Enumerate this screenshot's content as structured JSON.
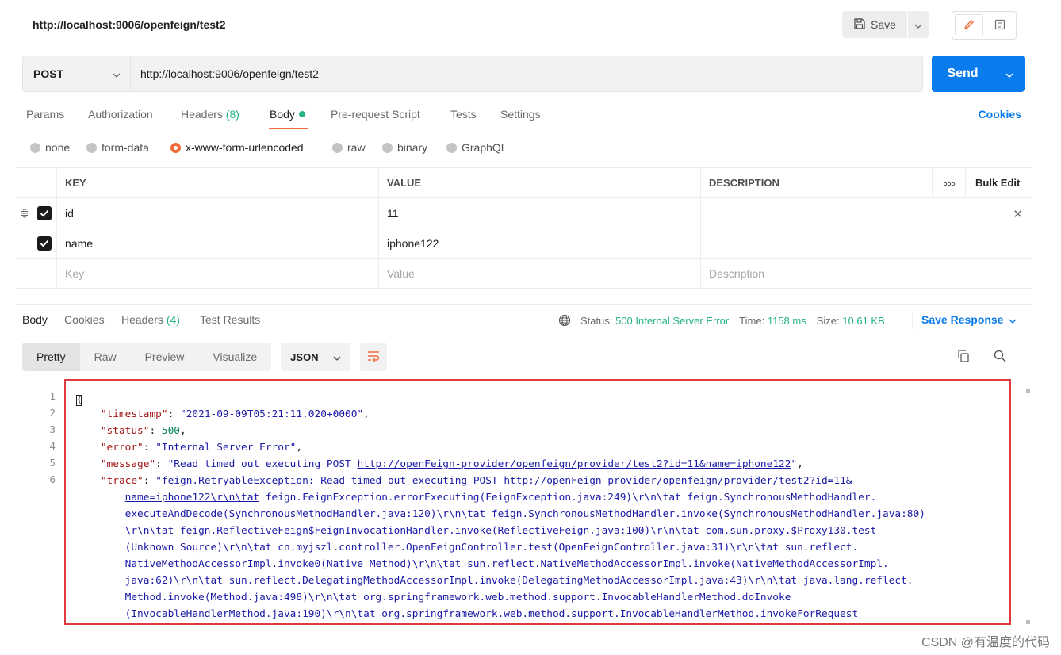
{
  "header": {
    "request_title": "http://localhost:9006/openfeign/test2",
    "save_label": "Save"
  },
  "url_bar": {
    "method": "POST",
    "url": "http://localhost:9006/openfeign/test2",
    "send_label": "Send"
  },
  "request_tabs": [
    {
      "label": "Params"
    },
    {
      "label": "Authorization"
    },
    {
      "label": "Headers",
      "count": "(8)"
    },
    {
      "label": "Body"
    },
    {
      "label": "Pre-request Script"
    },
    {
      "label": "Tests"
    },
    {
      "label": "Settings"
    }
  ],
  "cookies_label": "Cookies",
  "body_types": [
    "none",
    "form-data",
    "x-www-form-urlencoded",
    "raw",
    "binary",
    "GraphQL"
  ],
  "body_types_selected": "x-www-form-urlencoded",
  "params_table": {
    "headers": {
      "key": "KEY",
      "value": "VALUE",
      "description": "DESCRIPTION",
      "bulk_edit": "Bulk Edit"
    },
    "rows": [
      {
        "key": "id",
        "value": "11",
        "description": "",
        "checked": true
      },
      {
        "key": "name",
        "value": "iphone122",
        "description": "",
        "checked": true
      }
    ],
    "placeholders": {
      "key": "Key",
      "value": "Value",
      "description": "Description"
    }
  },
  "response": {
    "tabs": [
      {
        "label": "Body"
      },
      {
        "label": "Cookies"
      },
      {
        "label": "Headers",
        "count": "(4)"
      },
      {
        "label": "Test Results"
      }
    ],
    "status_label": "Status:",
    "status_value": "500 Internal Server Error",
    "time_label": "Time:",
    "time_value": "1158 ms",
    "size_label": "Size:",
    "size_value": "10.61 KB",
    "save_response_label": "Save Response",
    "format_tabs": [
      "Pretty",
      "Raw",
      "Preview",
      "Visualize"
    ],
    "language": "JSON",
    "line_numbers": [
      "1",
      "2",
      "3",
      "4",
      "5",
      "6"
    ],
    "json": {
      "open_brace": "{",
      "timestamp_key": "\"timestamp\"",
      "timestamp_value": "\"2021-09-09T05:21:11.020+0000\"",
      "status_key": "\"status\"",
      "status_value": "500",
      "error_key": "\"error\"",
      "error_value": "\"Internal Server Error\"",
      "message_key": "\"message\"",
      "message_prefix": "\"Read timed out executing POST ",
      "message_url": "http://openFeign-provider/openfeign/provider/test2?id=11&name=iphone122",
      "message_suffix": "\"",
      "trace_key": "\"trace\"",
      "trace_prefix": "\"feign.RetryableException: Read timed out executing POST ",
      "trace_url_1": "http://openFeign-provider/openfeign/provider/test2?id=11&",
      "trace_url_2": "name=iphone122\\r\\n\\tat",
      "trace_line_2_rest": " feign.FeignException.errorExecuting(FeignException.java:249)\\r\\n\\tat feign.SynchronousMethodHandler.",
      "trace_lines": [
        "executeAndDecode(SynchronousMethodHandler.java:120)\\r\\n\\tat feign.SynchronousMethodHandler.invoke(SynchronousMethodHandler.java:80)",
        "\\r\\n\\tat feign.ReflectiveFeign$FeignInvocationHandler.invoke(ReflectiveFeign.java:100)\\r\\n\\tat com.sun.proxy.$Proxy130.test",
        "(Unknown Source)\\r\\n\\tat cn.myjszl.controller.OpenFeignController.test(OpenFeignController.java:31)\\r\\n\\tat sun.reflect.",
        "NativeMethodAccessorImpl.invoke0(Native Method)\\r\\n\\tat sun.reflect.NativeMethodAccessorImpl.invoke(NativeMethodAccessorImpl.",
        "java:62)\\r\\n\\tat sun.reflect.DelegatingMethodAccessorImpl.invoke(DelegatingMethodAccessorImpl.java:43)\\r\\n\\tat java.lang.reflect.",
        "Method.invoke(Method.java:498)\\r\\n\\tat org.springframework.web.method.support.InvocableHandlerMethod.doInvoke",
        "(InvocableHandlerMethod.java:190)\\r\\n\\tat org.springframework.web.method.support.InvocableHandlerMethod.invokeForRequest"
      ]
    }
  },
  "watermark": "CSDN @有温度的代码",
  "colors": {
    "send": "#097bed",
    "accent_orange": "#f26b3a",
    "success_green": "#26b47f",
    "error_red": "#e5361b",
    "highlight_border": "#e0393e"
  }
}
